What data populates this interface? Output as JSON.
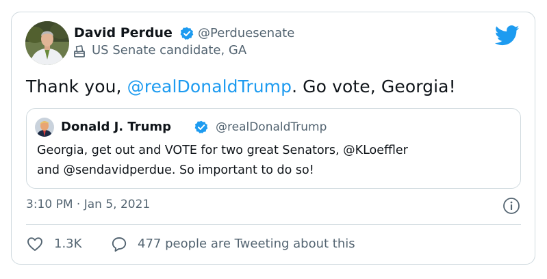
{
  "author": {
    "name": "David Perdue",
    "handle": "@Perduesenate",
    "label": "US Senate candidate, GA"
  },
  "tweet": {
    "text_before": "Thank you, ",
    "mention": "@realDonaldTrump",
    "text_after": ". Go vote, Georgia!"
  },
  "quote": {
    "name": "Donald J. Trump",
    "handle": "@realDonaldTrump",
    "line1": "Georgia, get out and VOTE for two great Senators, @KLoeffler",
    "line2": "and @sendavidperdue. So important to do so!"
  },
  "meta": {
    "time": "3:10 PM · Jan 5, 2021"
  },
  "actions": {
    "like_count": "1.3K",
    "reply_text": "477 people are Tweeting about this"
  },
  "colors": {
    "accent": "#1d9bf0",
    "text": "#0f1419",
    "secondary": "#536471",
    "border": "#cfd9de"
  },
  "icons": {
    "brand": "twitter-bird-icon",
    "verified": "verified-badge-icon",
    "label": "ballot-box-icon",
    "info": "info-icon",
    "like": "heart-icon",
    "reply": "speech-bubble-icon"
  }
}
